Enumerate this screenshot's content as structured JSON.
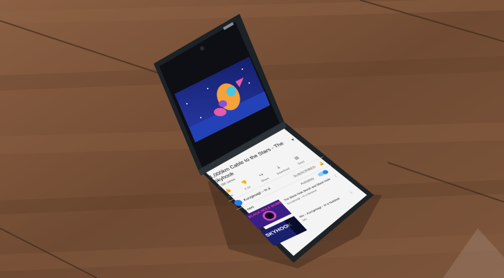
{
  "video": {
    "title_line1": "1,000km Cable to the Stars - The",
    "title_line2": "Skyhook",
    "meta": "3.3M views"
  },
  "actions": {
    "like_label": "59K",
    "dislike_label": "2.1K",
    "share_label": "Share",
    "download_label": "Download",
    "save_label": "Save"
  },
  "channel": {
    "name": "Kurzgesagt – In a",
    "subscribe_label": "SUBSCRIBED"
  },
  "autoplay": {
    "label": "Autoplay",
    "on": true
  },
  "up_next": {
    "heading": "Up next",
    "items": [
      {
        "thumb_text": "BLACK HOLE BOMB",
        "title": "The Black Hole Bomb and Black Hole",
        "subtitle": "Kurzgesagt – In a Nutshell"
      },
      {
        "thumb_text": "SKYHOOK",
        "title": "Mix – Kurzgesagt – In a Nutshell",
        "subtitle": "Mix"
      }
    ]
  },
  "colors": {
    "wood": "#7a5238",
    "phone_frame": "#1c2226",
    "video_sky": "#1b2a8c",
    "video_ground": "#2442b8",
    "accent_red": "#e53935",
    "thumb_purple": "#3a1e86"
  }
}
